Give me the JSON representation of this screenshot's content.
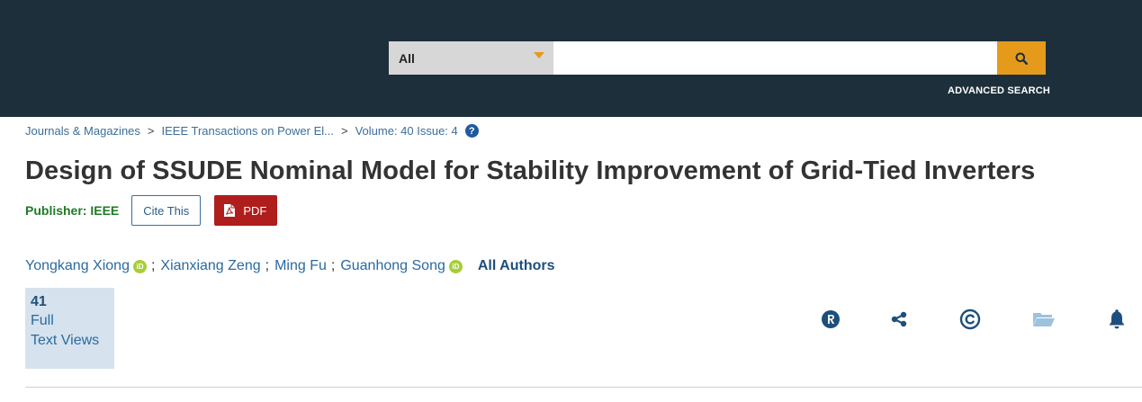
{
  "header": {
    "search_scope": "All",
    "search_value": "",
    "advanced_search_label": "ADVANCED SEARCH"
  },
  "breadcrumb": {
    "items": [
      "Journals & Magazines",
      "IEEE Transactions on Power El...",
      "Volume: 40 Issue: 4"
    ],
    "separator": ">",
    "help_glyph": "?"
  },
  "article": {
    "title": "Design of SSUDE Nominal Model for Stability Improvement of Grid-Tied Inverters",
    "publisher_label": "Publisher: IEEE",
    "cite_label": "Cite This",
    "pdf_label": "PDF"
  },
  "authors": {
    "list": [
      {
        "name": "Yongkang Xiong",
        "orcid": true
      },
      {
        "name": "Xianxiang Zeng",
        "orcid": false
      },
      {
        "name": "Ming Fu",
        "orcid": false
      },
      {
        "name": "Guanhong Song",
        "orcid": true
      }
    ],
    "separator": ";",
    "orcid_badge": "iD",
    "all_authors_label": "All Authors"
  },
  "metrics": {
    "count": "41",
    "line1": "Full",
    "line2": "Text Views"
  },
  "actions": [
    {
      "name": "rights-icon",
      "glyph": "R"
    },
    {
      "name": "share-icon"
    },
    {
      "name": "copyright-icon",
      "glyph": "©"
    },
    {
      "name": "folder-icon"
    },
    {
      "name": "alert-bell-icon"
    }
  ],
  "colors": {
    "header_bg": "#1d2f3a",
    "accent_orange": "#e59a1c",
    "link_blue": "#2b6aa0",
    "publisher_green": "#1f7a26",
    "pdf_red": "#b01d1d",
    "metric_bg": "#d6e2ed",
    "icon_navy": "#1d4f7c",
    "folder_light": "#9cc2de"
  }
}
